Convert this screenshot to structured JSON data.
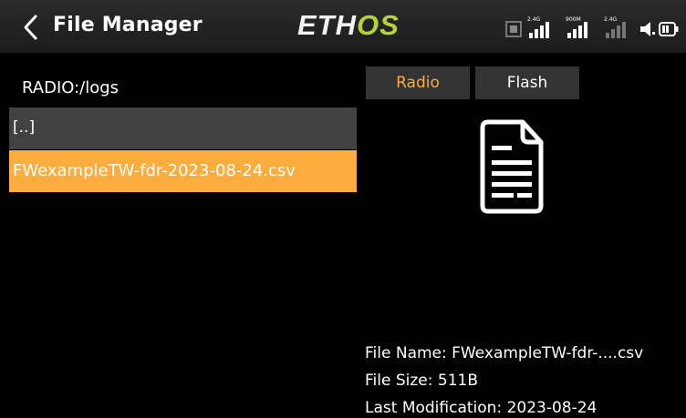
{
  "header": {
    "title": "File Manager",
    "brand_prefix": "ETH",
    "brand_suffix": "OS",
    "signal_labels": [
      "2.4G",
      "900M",
      "2.4G"
    ]
  },
  "colors": {
    "accent_orange": "#fdac3e",
    "brand_green": "#b5d334",
    "header_bg": "#2b2b2b",
    "row_gray": "#424242",
    "tab_bg": "#333333"
  },
  "file_list": {
    "path": "RADIO:/logs",
    "parent_entry": "[..]",
    "items": [
      {
        "label": "FWexampleTW-fdr-2023-08-24.csv",
        "selected": true
      }
    ]
  },
  "tabs": [
    {
      "label": "Radio",
      "active": true
    },
    {
      "label": "Flash",
      "active": false
    }
  ],
  "file_info": {
    "name": "File Name: FWexampleTW-fdr-....csv",
    "size": "File Size: 511B",
    "modified": "Last Modification: 2023-08-24"
  },
  "icons": {
    "back": "chevron-left-icon",
    "document": "document-icon",
    "signal": "signal-bars-icon",
    "speaker": "speaker-icon",
    "battery": "battery-icon"
  }
}
